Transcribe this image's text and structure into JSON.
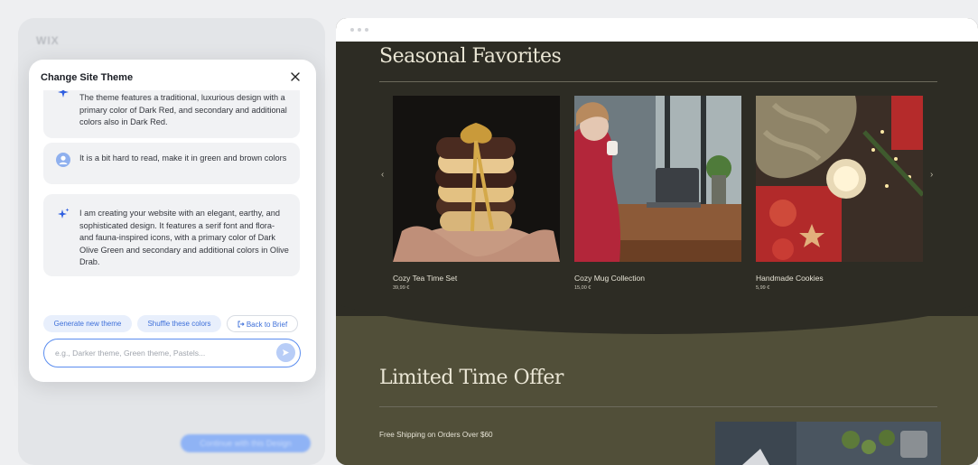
{
  "editor": {
    "logo": "WIX",
    "continue_label": "Continue with this Design"
  },
  "modal": {
    "title": "Change Site Theme",
    "messages": [
      {
        "role": "ai",
        "text": "The theme features a traditional, luxurious design with a primary color of Dark Red, and secondary and additional colors also in Dark Red."
      },
      {
        "role": "user",
        "text": "It is a bit hard to read, make it in green and brown colors"
      },
      {
        "role": "ai",
        "text": "I am creating your website with an elegant, earthy, and sophisticated design. It features a serif font and flora- and fauna-inspired icons, with a primary color of Dark Olive Green and secondary and additional colors in Olive Drab."
      }
    ],
    "actions": {
      "generate": "Generate new theme",
      "shuffle": "Shuffle these colors",
      "back": "Back to Brief"
    },
    "input": {
      "placeholder": "e.g., Darker theme, Green theme, Pastels...",
      "value": ""
    }
  },
  "preview": {
    "section1_title": "Seasonal Favorites",
    "products": [
      {
        "name": "Cozy Tea Time Set",
        "price": "39,99 €"
      },
      {
        "name": "Cozy Mug Collection",
        "price": "15,00 €"
      },
      {
        "name": "Handmade Cookies",
        "price": "5,99 €"
      }
    ],
    "section2_title": "Limited Time Offer",
    "offer_text": "Free Shipping on Orders Over $60",
    "arrow_left": "‹",
    "arrow_right": "›"
  },
  "colors": {
    "accent": "#5b8def",
    "preview_dark": "#2d2c24",
    "preview_olive": "#514f39"
  }
}
